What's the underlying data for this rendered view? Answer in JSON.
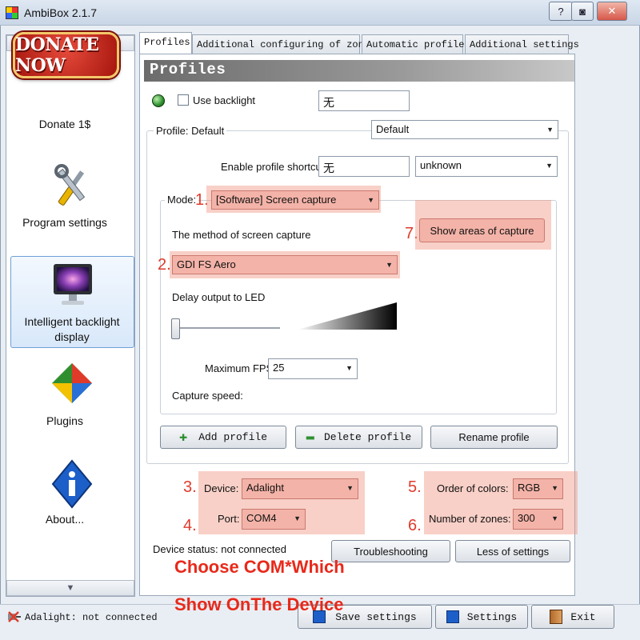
{
  "window": {
    "title": "AmbiBox 2.1.7",
    "controls": [
      "?",
      "◙",
      "✕"
    ]
  },
  "sidebar": {
    "items": [
      {
        "label": "Donate 1$",
        "badge": "DONATE NOW"
      },
      {
        "label": "Program settings"
      },
      {
        "label": "Intelligent backlight display"
      },
      {
        "label": "Plugins"
      },
      {
        "label": "About..."
      }
    ]
  },
  "tabs": [
    "Profiles",
    "Additional configuring of zones",
    "Automatic profiles",
    "Additional settings"
  ],
  "profiles": {
    "heading": "Profiles",
    "use_backlight_label": "Use backlight",
    "backlight_hotkey": "无",
    "profile_label": "Profile: Default",
    "profile_value": "Default",
    "shortcut_label": "Enable profile shortcut:",
    "shortcut_value": "无",
    "shortcut_key": "unknown",
    "mode_label": "Mode:",
    "mode_value": "[Software] Screen capture",
    "capture_method_label": "The method of screen capture",
    "capture_method_value": "GDI FS Aero",
    "show_areas_label": "Show areas of capture",
    "delay_label": "Delay output to LED",
    "max_fps_label": "Maximum FPS",
    "max_fps_value": "25",
    "capture_speed_label": "Capture speed:",
    "add_profile": "Add profile",
    "delete_profile": "Delete profile",
    "rename_profile": "Rename profile"
  },
  "device": {
    "device_label": "Device:",
    "device_value": "Adalight",
    "port_label": "Port:",
    "port_value": "COM4",
    "order_label": "Order of colors:",
    "order_value": "RGB",
    "zones_label": "Number of zones:",
    "zones_value": "300",
    "status": "Device status: not connected",
    "troubleshooting": "Troubleshooting",
    "less_settings": "Less of settings"
  },
  "markers": [
    "1.",
    "2.",
    "3.",
    "4.",
    "5.",
    "6.",
    "7."
  ],
  "annotation": {
    "line1": "Choose COM*Which",
    "line2": "Show OnThe Device"
  },
  "status_bar": {
    "connection": "Adalight: not connected",
    "save_settings": "Save settings",
    "settings": "Settings",
    "exit": "Exit"
  },
  "colors": {
    "highlight": "#f4b3a8",
    "annotation_red": "#e8291a",
    "status_green": "#2f8f2f",
    "donate_red": "#c8261a"
  },
  "icons": {
    "status_led": "green-led-icon",
    "tools": "wrench-screwdriver-icon",
    "monitor": "monitor-icon",
    "plugins": "puzzle-icon",
    "about": "info-icon",
    "add": "plus-icon",
    "delete": "minus-icon",
    "save": "save-disk-icon",
    "settings_btn": "settings-disk-icon",
    "exit": "exit-door-icon"
  }
}
